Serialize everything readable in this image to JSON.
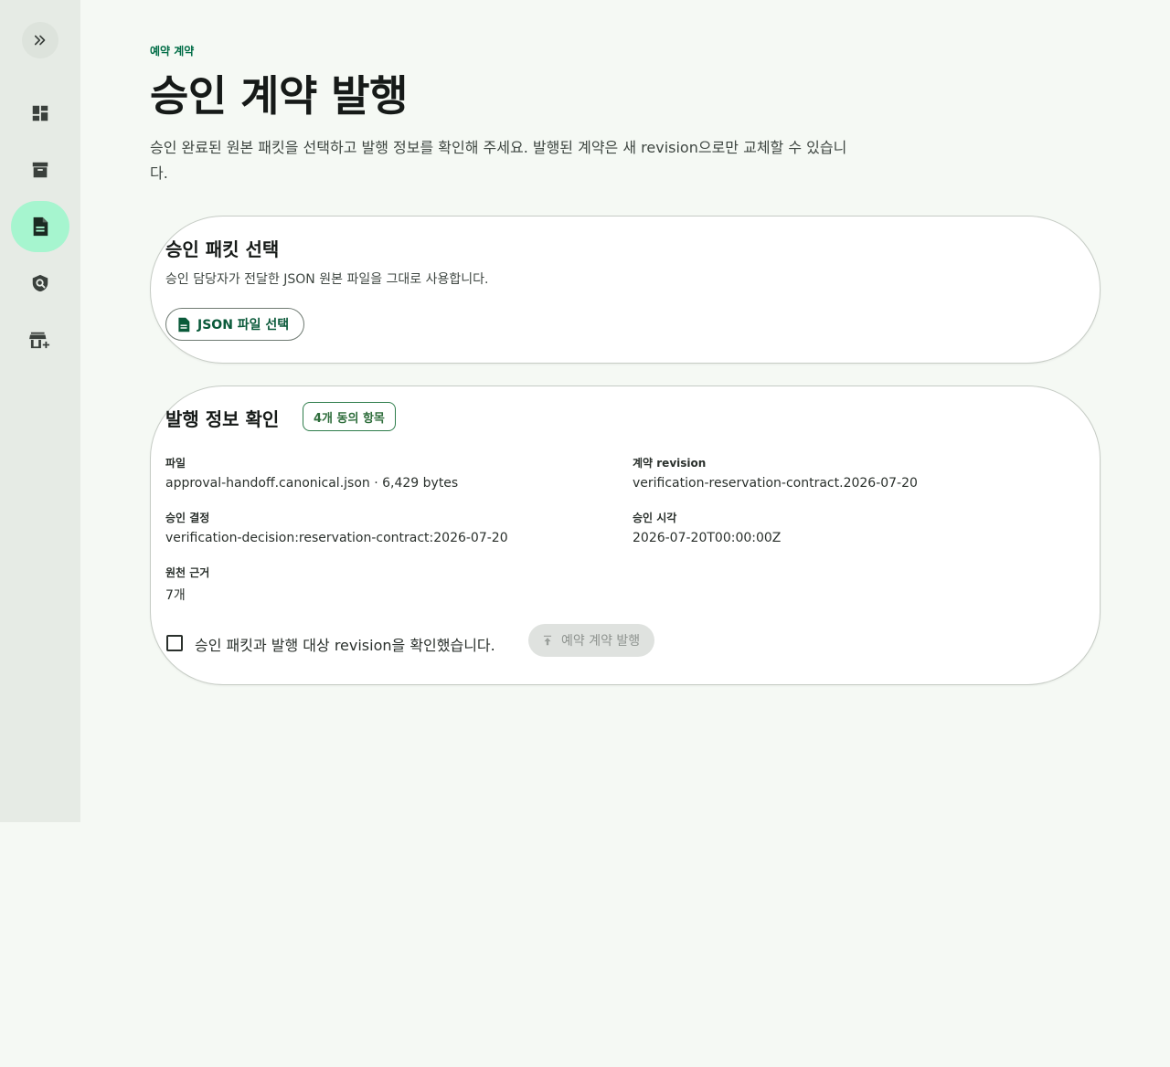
{
  "nav": {
    "items": [
      {
        "name": "dashboard",
        "icon": "dashboard-icon"
      },
      {
        "name": "archive",
        "icon": "archive-icon"
      },
      {
        "name": "contract",
        "icon": "document-icon",
        "active": true
      },
      {
        "name": "verification",
        "icon": "shield-search-icon"
      },
      {
        "name": "add-store",
        "icon": "add-business-icon"
      }
    ]
  },
  "header": {
    "eyebrow": "예약 계약",
    "title": "승인 계약 발행",
    "description": "승인 완료된 원본 패킷을 선택하고 발행 정보를 확인해 주세요. 발행된 계약은 새 revision으로만 교체할 수 있습니다."
  },
  "packet_card": {
    "title": "승인 패킷 선택",
    "subtitle": "승인 담당자가 전달한 JSON 원본 파일을 그대로 사용합니다.",
    "select_button": "JSON 파일 선택"
  },
  "review_card": {
    "title": "발행 정보 확인",
    "badge": "4개 동의 항목",
    "fields": {
      "file_label": "파일",
      "file_value": "approval-handoff.canonical.json · 6,429 bytes",
      "revision_label": "계약 revision",
      "revision_value": "verification-reservation-contract.2026-07-20",
      "decision_label": "승인 결정",
      "decision_value": "verification-decision:reservation-contract:2026-07-20",
      "time_label": "승인 시각",
      "time_value": "2026-07-20T00:00:00Z",
      "evidence_label": "원천 근거",
      "evidence_value": "7개"
    },
    "confirm_label": "승인 패킷과 발행 대상 revision을 확인했습니다.",
    "publish_button": "예약 계약 발행"
  },
  "colors": {
    "accent": "#006d46",
    "active_nav": "#a6f5cf",
    "background": "#f5f9f4"
  }
}
